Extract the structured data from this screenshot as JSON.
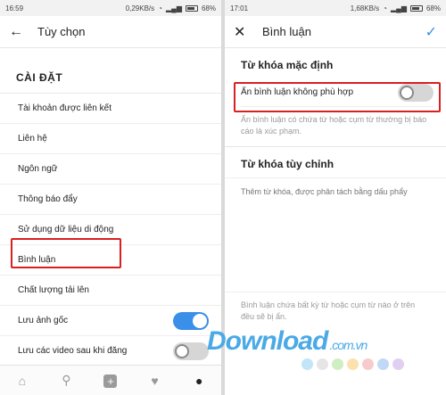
{
  "left": {
    "status": {
      "time": "16:59",
      "speed": "0,29KB/s",
      "battery": "68%"
    },
    "appbar": {
      "title": "Tùy chọn"
    },
    "section": "CÀI ĐẶT",
    "items": [
      {
        "label": "Tài khoản được liên kết"
      },
      {
        "label": "Liên hệ"
      },
      {
        "label": "Ngôn ngữ"
      },
      {
        "label": "Thông báo đẩy"
      },
      {
        "label": "Sử dụng dữ liệu di động"
      },
      {
        "label": "Bình luận"
      },
      {
        "label": "Chất lượng tải lên"
      },
      {
        "label": "Lưu ảnh gốc",
        "toggle": "on"
      },
      {
        "label": "Lưu các video sau khi đăng",
        "toggle": "off"
      }
    ]
  },
  "right": {
    "status": {
      "time": "17:01",
      "speed": "1,68KB/s",
      "battery": "68%"
    },
    "appbar": {
      "title": "Bình luận"
    },
    "default_keywords": {
      "heading": "Từ khóa mặc định",
      "toggle_label": "Ẩn bình luận không phù hợp",
      "toggle": "off",
      "hint": "Ẩn bình luận có chứa từ hoặc cụm từ thường bị báo cáo là xúc phạm."
    },
    "custom_keywords": {
      "heading": "Từ khóa tùy chỉnh",
      "placeholder": "Thêm từ khóa, được phân tách bằng dấu phẩy",
      "hint": "Bình luận chứa bất kỳ từ hoặc cụm từ nào ở trên đều sẽ bị ẩn."
    }
  },
  "watermark": {
    "brand": "Download",
    "suffix": ".com.vn"
  },
  "colors": {
    "accent": "#3a8fe8",
    "highlight": "#d82020"
  }
}
